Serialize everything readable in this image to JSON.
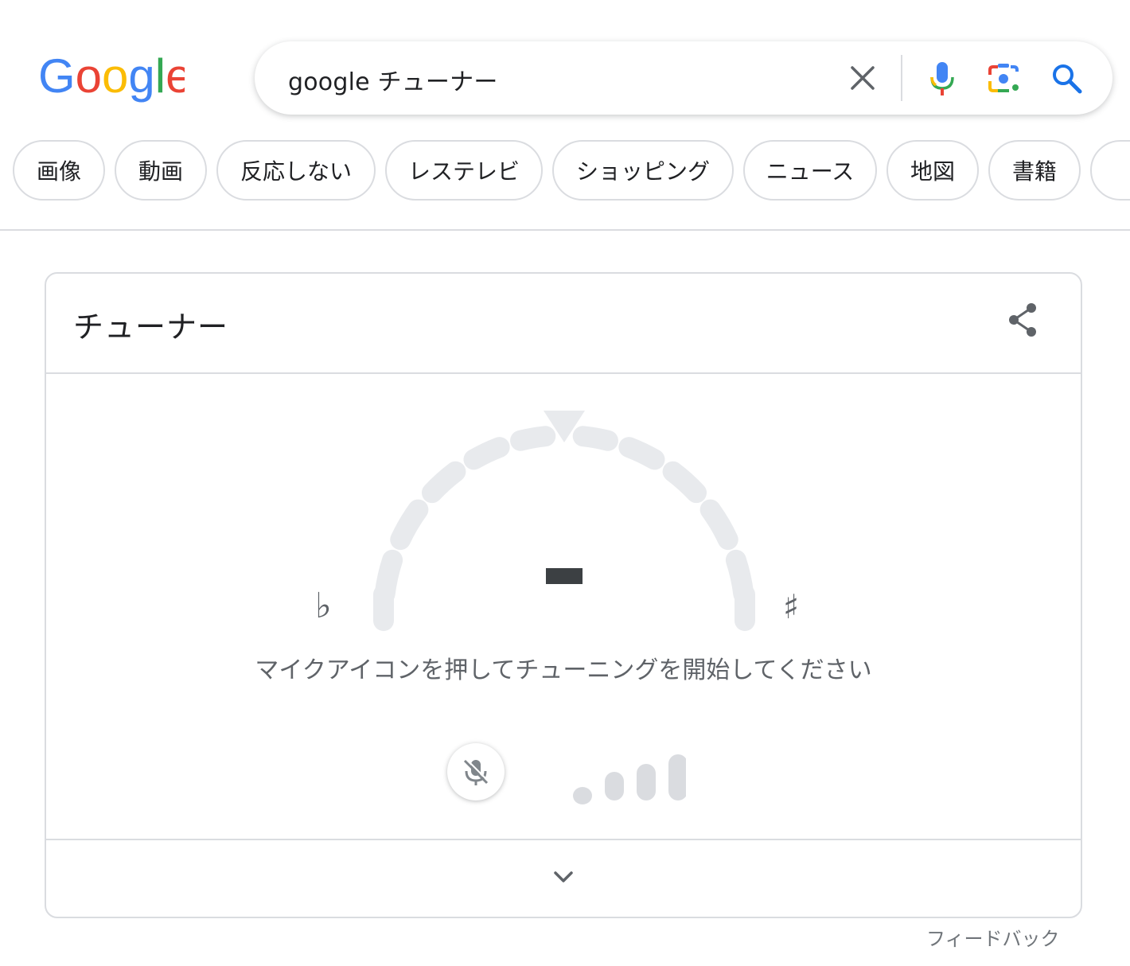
{
  "header": {
    "logo_text": "Google",
    "search": {
      "query": "google チューナー",
      "icons": [
        "close-icon",
        "mic-icon",
        "lens-icon",
        "search-icon"
      ]
    }
  },
  "chips": [
    "画像",
    "動画",
    "反応しない",
    "レステレビ",
    "ショッピング",
    "ニュース",
    "地図",
    "書籍"
  ],
  "tuner": {
    "title": "チューナー",
    "flat_symbol": "♭",
    "sharp_symbol": "♯",
    "instruction": "マイクアイコンを押してチューニングを開始してください",
    "icons": [
      "share-icon",
      "mic-off-icon",
      "chevron-down-icon"
    ],
    "signal_level": 0,
    "colors": {
      "inactive": "#e8eaed",
      "level_bars": "#dadce0",
      "note": "#3c4043"
    }
  },
  "feedback": "フィードバック",
  "colors": {
    "google_blue": "#4285f4",
    "google_red": "#ea4335",
    "google_yellow": "#fbbc05",
    "google_green": "#34a853",
    "search_blue": "#1a73e8"
  }
}
